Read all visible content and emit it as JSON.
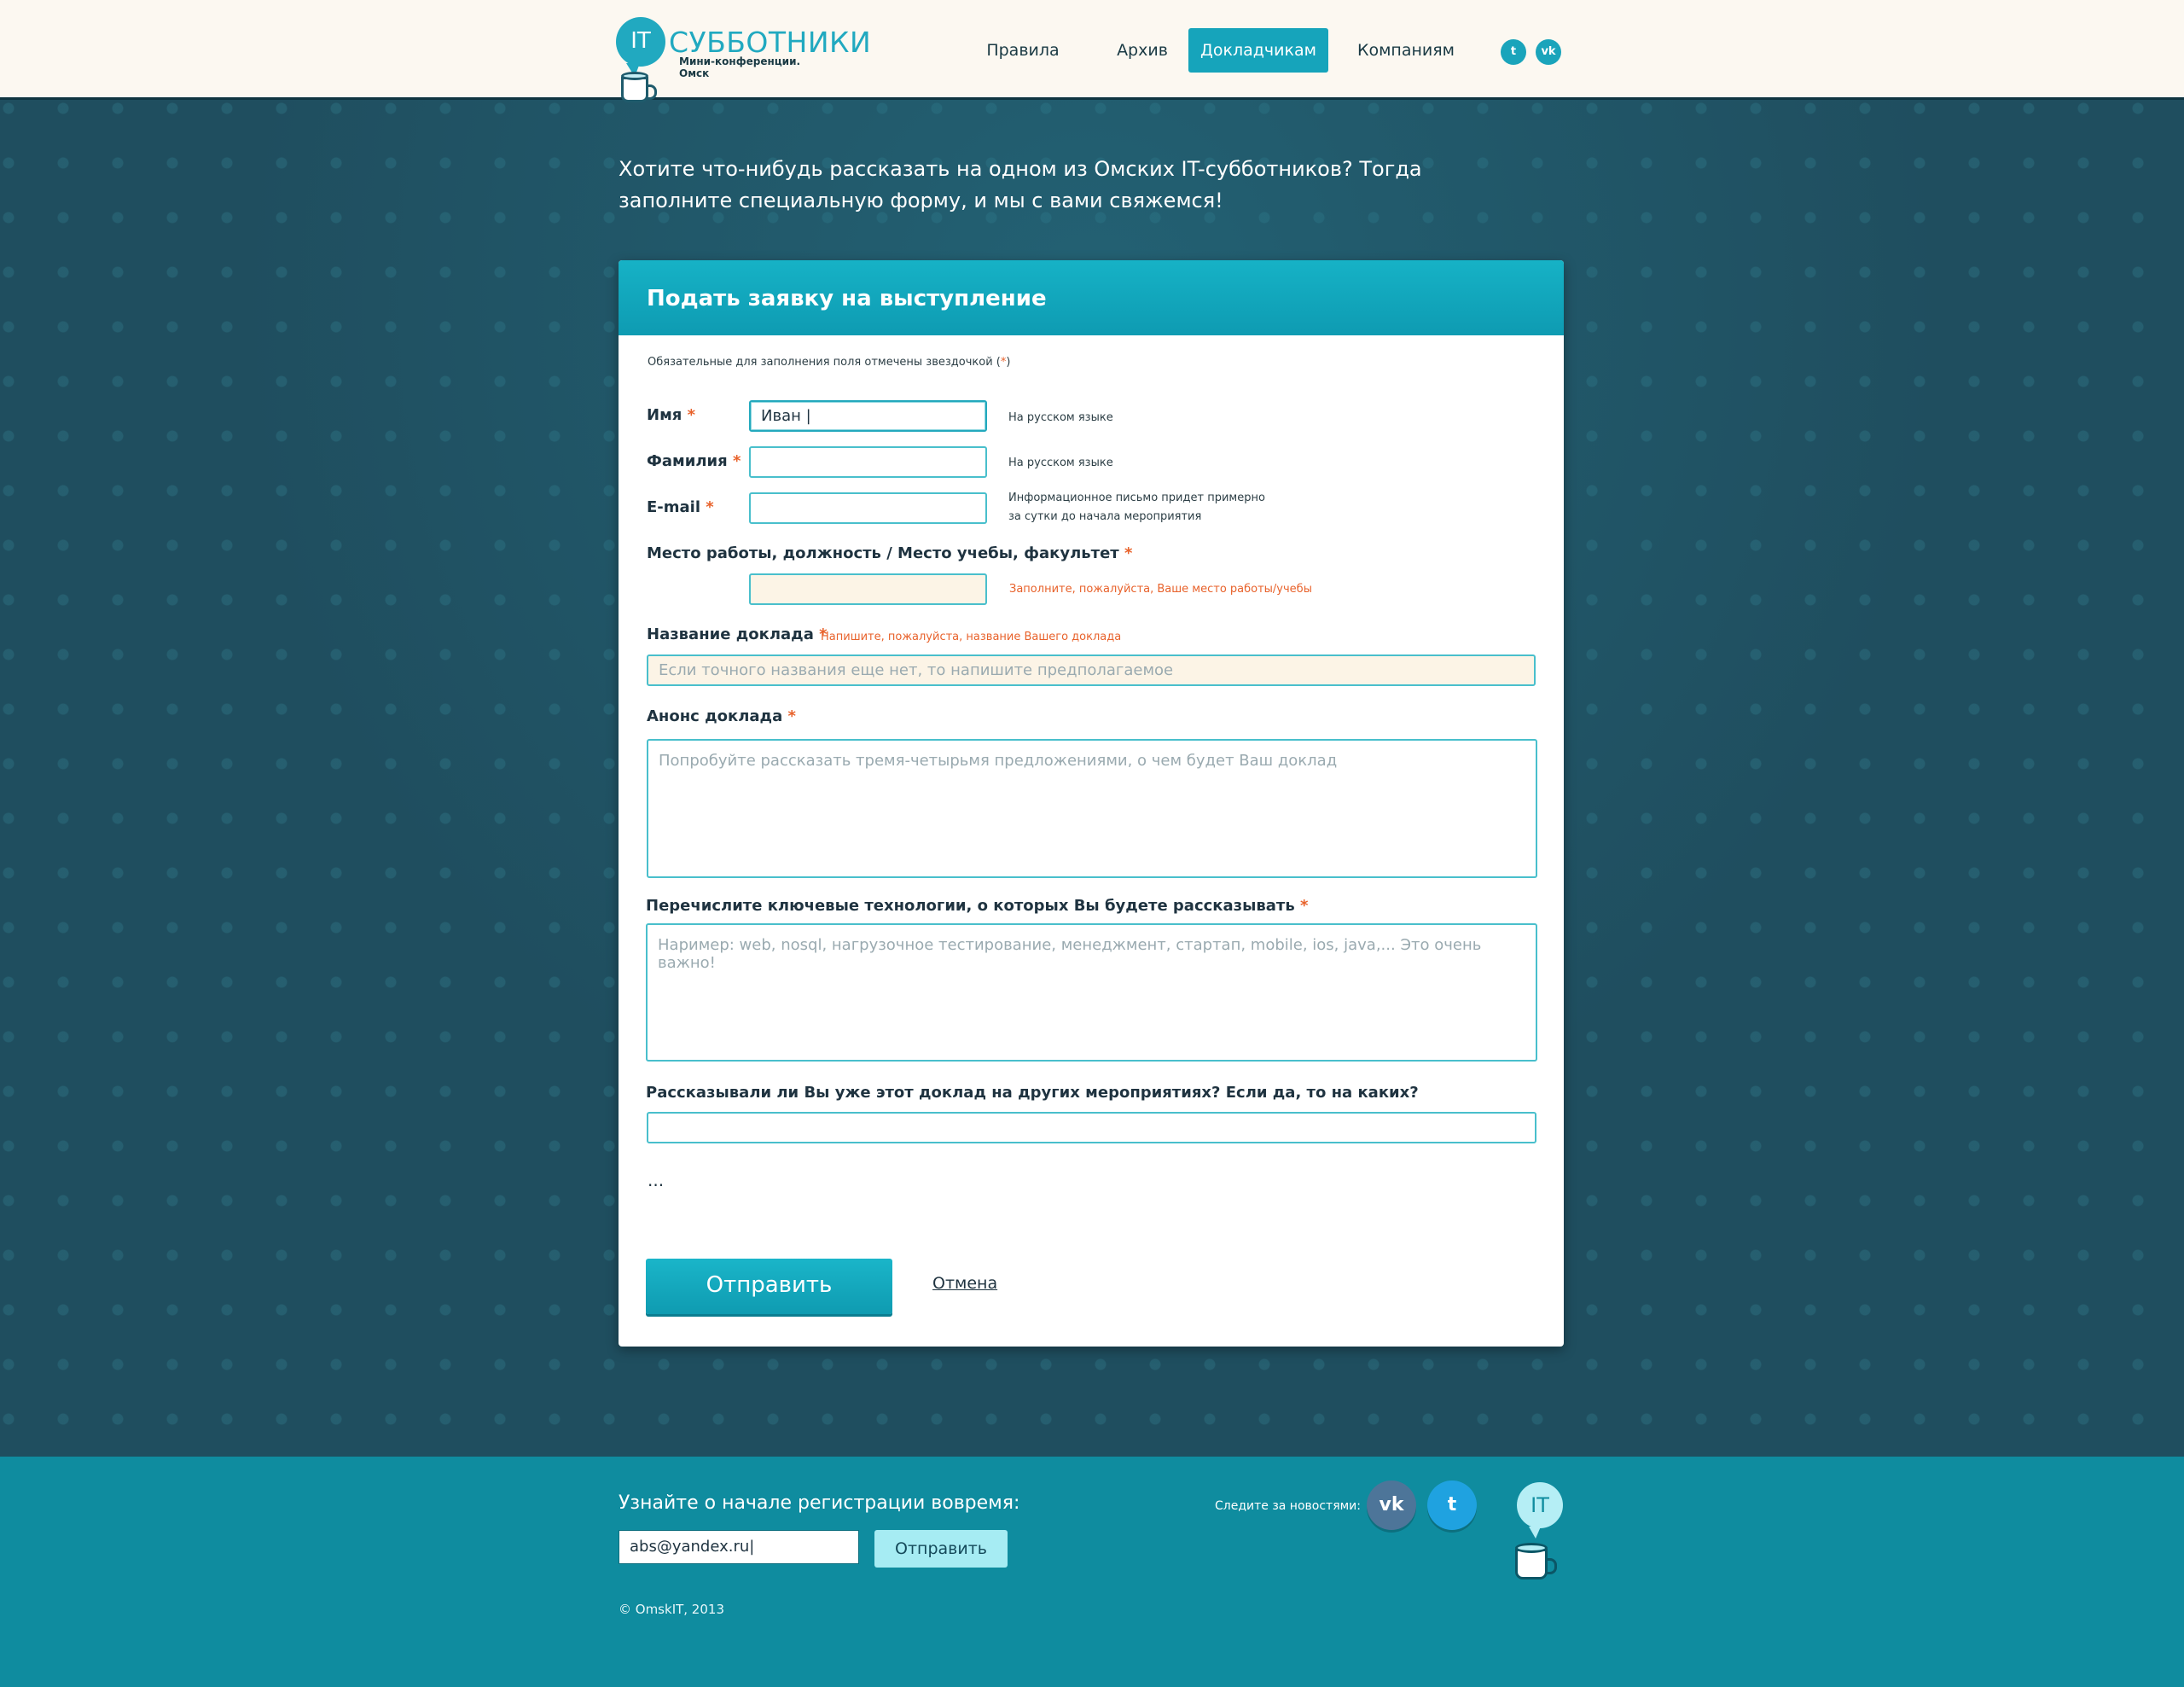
{
  "header": {
    "logo": {
      "badge": "IT",
      "title": "СУББОТНИКИ",
      "subtitle": "Мини-конференции. Омск"
    },
    "nav": [
      {
        "label": "Правила",
        "active": false
      },
      {
        "label": "Архив",
        "active": false
      },
      {
        "label": "Докладчикам",
        "active": true
      },
      {
        "label": "Компаниям",
        "active": false
      }
    ],
    "social": [
      {
        "icon": "twitter-icon",
        "glyph": "t"
      },
      {
        "icon": "vk-icon",
        "glyph": "vk"
      }
    ]
  },
  "intro": "Хотите что-нибудь рассказать на одном из Омских IT-субботников? Тогда заполните специальную форму, и мы с вами свяжемся!",
  "form": {
    "title": "Подать заявку на выступление",
    "required_note": "Обязательные для заполнения поля отмечены звездочкой (",
    "required_note_star": "*",
    "required_note_end": ")",
    "star": "*",
    "first_name": {
      "label": "Имя",
      "value": "Иван |",
      "hint": "На русском языке"
    },
    "last_name": {
      "label": "Фамилия",
      "value": "",
      "hint": "На русском языке"
    },
    "email": {
      "label": "E-mail",
      "value": "",
      "hint_line1": "Информационное письмо придет примерно",
      "hint_line2": "за сутки до начала мероприятия"
    },
    "workplace": {
      "label": "Место работы, должность / Место учебы, факультет",
      "value": "",
      "error": "Заполните, пожалуйста, Ваше место работы/учебы"
    },
    "talk_title": {
      "label": "Название доклада",
      "error": "Напишите, пожалуйста, название Вашего доклада",
      "placeholder": "Если точного названия еще нет, то напишите предполагаемое"
    },
    "abstract": {
      "label": "Анонс доклада",
      "placeholder": "Попробуйте рассказать тремя-четырьмя предложениями, о чем будет Ваш доклад"
    },
    "technologies": {
      "label": "Перечислите ключевые технологии, о которых Вы будете рассказывать",
      "placeholder": "Наример: web, nosql, нагрузочное тестирование, менеджмент, стартап, mobile, ios, java,... Это очень важно!"
    },
    "prior_events": {
      "label": "Рассказывали ли Вы уже этот доклад на других мероприятиях? Если да, то на каких?",
      "value": ""
    },
    "ellipsis": "...",
    "submit_label": "Отправить",
    "cancel_label": "Отмена"
  },
  "footer": {
    "subscribe_title": "Узнайте о начале регистрации вовремя:",
    "email_value": "abs@yandex.ru|",
    "subscribe_button": "Отправить",
    "follow_label": "Следите за новостями:",
    "social": [
      {
        "icon": "vk-icon",
        "glyph": "vk",
        "color": "#4d7599"
      },
      {
        "icon": "twitter-icon",
        "glyph": "t",
        "color": "#1fa2e0"
      }
    ],
    "logo_badge": "IT",
    "copyright": "©  OmskIT, 2013"
  },
  "colors": {
    "accent": "#16a4bb",
    "background": "#1f4e5f",
    "footer": "#0f8c9f",
    "error": "#e8622b"
  }
}
